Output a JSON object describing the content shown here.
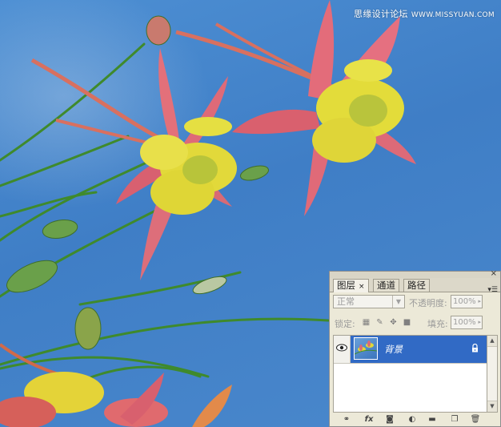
{
  "watermark": {
    "text": "思缘设计论坛",
    "site": "WWW.MISSYUAN.COM"
  },
  "layers_panel": {
    "tabs": [
      {
        "label": "图层",
        "active": true
      },
      {
        "label": "通道",
        "active": false
      },
      {
        "label": "路径",
        "active": false
      }
    ],
    "tab_close": "×",
    "blend_mode": "正常",
    "opacity_label": "不透明度:",
    "opacity_value": "100%",
    "lock_label": "锁定:",
    "fill_label": "填充:",
    "fill_value": "100%",
    "layers": [
      {
        "name": "背景",
        "visible": true,
        "locked": true,
        "selected": true
      }
    ],
    "bottom_icons": [
      "link-icon",
      "fx-icon",
      "mask-icon",
      "adjustment-icon",
      "folder-icon",
      "new-layer-icon",
      "trash-icon"
    ],
    "fx_label": "fx"
  },
  "colors": {
    "sky": "#3f7ec6",
    "selection": "#316ac5",
    "panel": "#ece9d8"
  }
}
